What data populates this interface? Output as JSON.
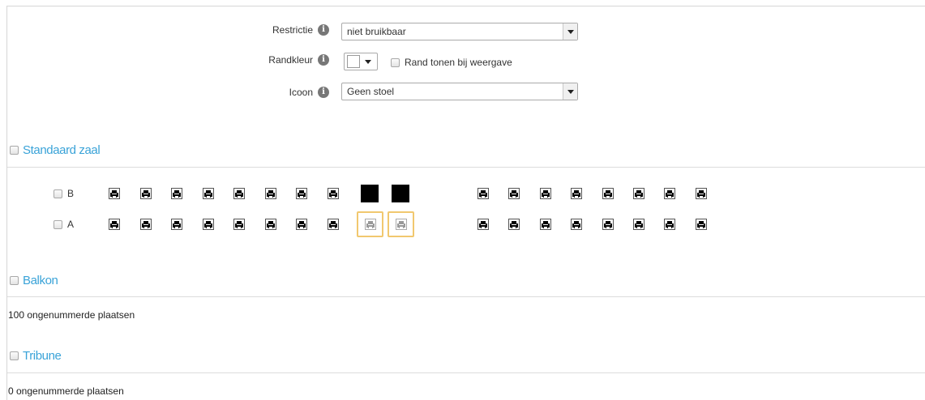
{
  "form": {
    "restriction": {
      "label": "Restrictie",
      "value": "niet bruikbaar"
    },
    "border_color": {
      "label": "Randkleur",
      "swatch": "#ffffff",
      "checkbox_label": "Rand tonen bij weergave"
    },
    "icon": {
      "label": "Icoon",
      "value": "Geen stoel"
    }
  },
  "sections": {
    "standard": {
      "title": "Standaard zaal",
      "rows": [
        {
          "label": "B",
          "left_seats": [
            "seat",
            "seat",
            "seat",
            "seat",
            "seat",
            "seat",
            "seat",
            "seat",
            "blocked",
            "blocked"
          ],
          "right_seats": [
            "seat",
            "seat",
            "seat",
            "seat",
            "seat",
            "seat",
            "seat",
            "seat"
          ]
        },
        {
          "label": "A",
          "left_seats": [
            "seat",
            "seat",
            "seat",
            "seat",
            "seat",
            "seat",
            "seat",
            "seat",
            "selected",
            "selected"
          ],
          "right_seats": [
            "seat",
            "seat",
            "seat",
            "seat",
            "seat",
            "seat",
            "seat",
            "seat"
          ]
        }
      ]
    },
    "balcony": {
      "title": "Balkon",
      "info": "100 ongenummerde plaatsen"
    },
    "tribune": {
      "title": "Tribune",
      "info": "0 ongenummerde plaatsen"
    }
  },
  "colors": {
    "accent": "#3aa3d8",
    "selection_border": "#f1c86f",
    "blocked": "#000000"
  },
  "icons": {
    "info": "info-icon",
    "seat": "armchair-icon",
    "dropdown": "chevron-down-icon"
  }
}
